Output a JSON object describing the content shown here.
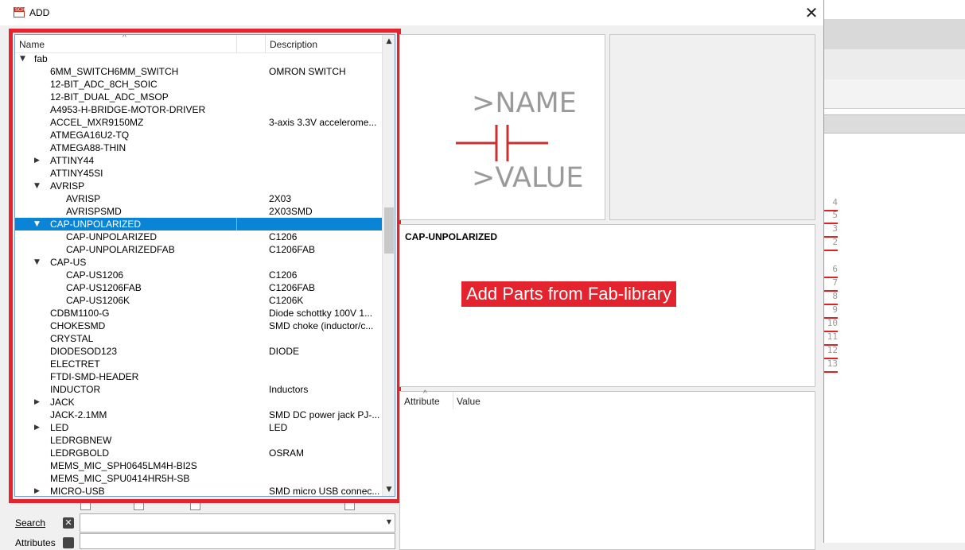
{
  "window": {
    "title": "ADD",
    "app_icon": "sch-icon",
    "app_icon_text": "SCH"
  },
  "tree": {
    "columns": [
      "Name",
      "Description"
    ],
    "rows": [
      {
        "name": "fab",
        "desc": "",
        "level": 0,
        "arrow": "expanded"
      },
      {
        "name": "6MM_SWITCH6MM_SWITCH",
        "desc": "OMRON SWITCH",
        "level": 1,
        "arrow": ""
      },
      {
        "name": "12-BIT_ADC_8CH_SOIC",
        "desc": "",
        "level": 1,
        "arrow": ""
      },
      {
        "name": "12-BIT_DUAL_ADC_MSOP",
        "desc": "",
        "level": 1,
        "arrow": ""
      },
      {
        "name": "A4953-H-BRIDGE-MOTOR-DRIVER",
        "desc": "",
        "level": 1,
        "arrow": ""
      },
      {
        "name": "ACCEL_MXR9150MZ",
        "desc": "3-axis 3.3V accelerome...",
        "level": 1,
        "arrow": ""
      },
      {
        "name": "ATMEGA16U2-TQ",
        "desc": "",
        "level": 1,
        "arrow": ""
      },
      {
        "name": "ATMEGA88-THIN",
        "desc": "",
        "level": 1,
        "arrow": ""
      },
      {
        "name": "ATTINY44",
        "desc": "",
        "level": 1,
        "arrow": "collapsed"
      },
      {
        "name": "ATTINY45SI",
        "desc": "",
        "level": 1,
        "arrow": ""
      },
      {
        "name": "AVRISP",
        "desc": "",
        "level": 1,
        "arrow": "expanded"
      },
      {
        "name": "AVRISP",
        "desc": "2X03",
        "level": 2,
        "arrow": ""
      },
      {
        "name": "AVRISPSMD",
        "desc": "2X03SMD",
        "level": 2,
        "arrow": ""
      },
      {
        "name": "CAP-UNPOLARIZED",
        "desc": "",
        "level": 1,
        "arrow": "expanded",
        "selected": true
      },
      {
        "name": "CAP-UNPOLARIZED",
        "desc": "C1206",
        "level": 2,
        "arrow": ""
      },
      {
        "name": "CAP-UNPOLARIZEDFAB",
        "desc": "C1206FAB",
        "level": 2,
        "arrow": ""
      },
      {
        "name": "CAP-US",
        "desc": "",
        "level": 1,
        "arrow": "expanded"
      },
      {
        "name": "CAP-US1206",
        "desc": "C1206",
        "level": 2,
        "arrow": ""
      },
      {
        "name": "CAP-US1206FAB",
        "desc": "C1206FAB",
        "level": 2,
        "arrow": ""
      },
      {
        "name": "CAP-US1206K",
        "desc": "C1206K",
        "level": 2,
        "arrow": ""
      },
      {
        "name": "CDBM1100-G",
        "desc": "Diode schottky 100V 1...",
        "level": 1,
        "arrow": ""
      },
      {
        "name": "CHOKESMD",
        "desc": "SMD choke (inductor/c...",
        "level": 1,
        "arrow": ""
      },
      {
        "name": "CRYSTAL",
        "desc": "",
        "level": 1,
        "arrow": ""
      },
      {
        "name": "DIODESOD123",
        "desc": "DIODE",
        "level": 1,
        "arrow": ""
      },
      {
        "name": "ELECTRET",
        "desc": "",
        "level": 1,
        "arrow": ""
      },
      {
        "name": "FTDI-SMD-HEADER",
        "desc": "",
        "level": 1,
        "arrow": ""
      },
      {
        "name": "INDUCTOR",
        "desc": "Inductors",
        "level": 1,
        "arrow": ""
      },
      {
        "name": "JACK",
        "desc": "",
        "level": 1,
        "arrow": "collapsed"
      },
      {
        "name": "JACK-2.1MM",
        "desc": "SMD DC power jack PJ-...",
        "level": 1,
        "arrow": ""
      },
      {
        "name": "LED",
        "desc": "LED",
        "level": 1,
        "arrow": "collapsed"
      },
      {
        "name": "LEDRGBNEW",
        "desc": "",
        "level": 1,
        "arrow": ""
      },
      {
        "name": "LEDRGBOLD",
        "desc": "OSRAM",
        "level": 1,
        "arrow": ""
      },
      {
        "name": "MEMS_MIC_SPH0645LM4H-BI2S",
        "desc": "",
        "level": 1,
        "arrow": ""
      },
      {
        "name": "MEMS_MIC_SPU0414HR5H-SB",
        "desc": "",
        "level": 1,
        "arrow": ""
      },
      {
        "name": "MICRO-USB",
        "desc": "SMD micro USB connec...",
        "level": 1,
        "arrow": "collapsed"
      }
    ]
  },
  "symbol_preview": {
    "name_text": ">NAME",
    "value_text": ">VALUE"
  },
  "description_panel": {
    "title": "CAP-UNPOLARIZED"
  },
  "annotation": {
    "text": "Add Parts from Fab-library",
    "color": "#e3232d"
  },
  "attributes_panel": {
    "columns": [
      "Attribute",
      "Value"
    ]
  },
  "search": {
    "label": "Search",
    "value": ""
  },
  "attributes_filter": {
    "label": "Attributes"
  },
  "background_pins": [
    "4",
    "5",
    "3",
    "2",
    "6",
    "7",
    "8",
    "9",
    "10",
    "11",
    "12",
    "13"
  ],
  "colors": {
    "selection": "#0a84d6",
    "highlight_frame": "#e3232d",
    "symbol_line": "#c8312f",
    "symbol_text": "#9a9a9a"
  }
}
